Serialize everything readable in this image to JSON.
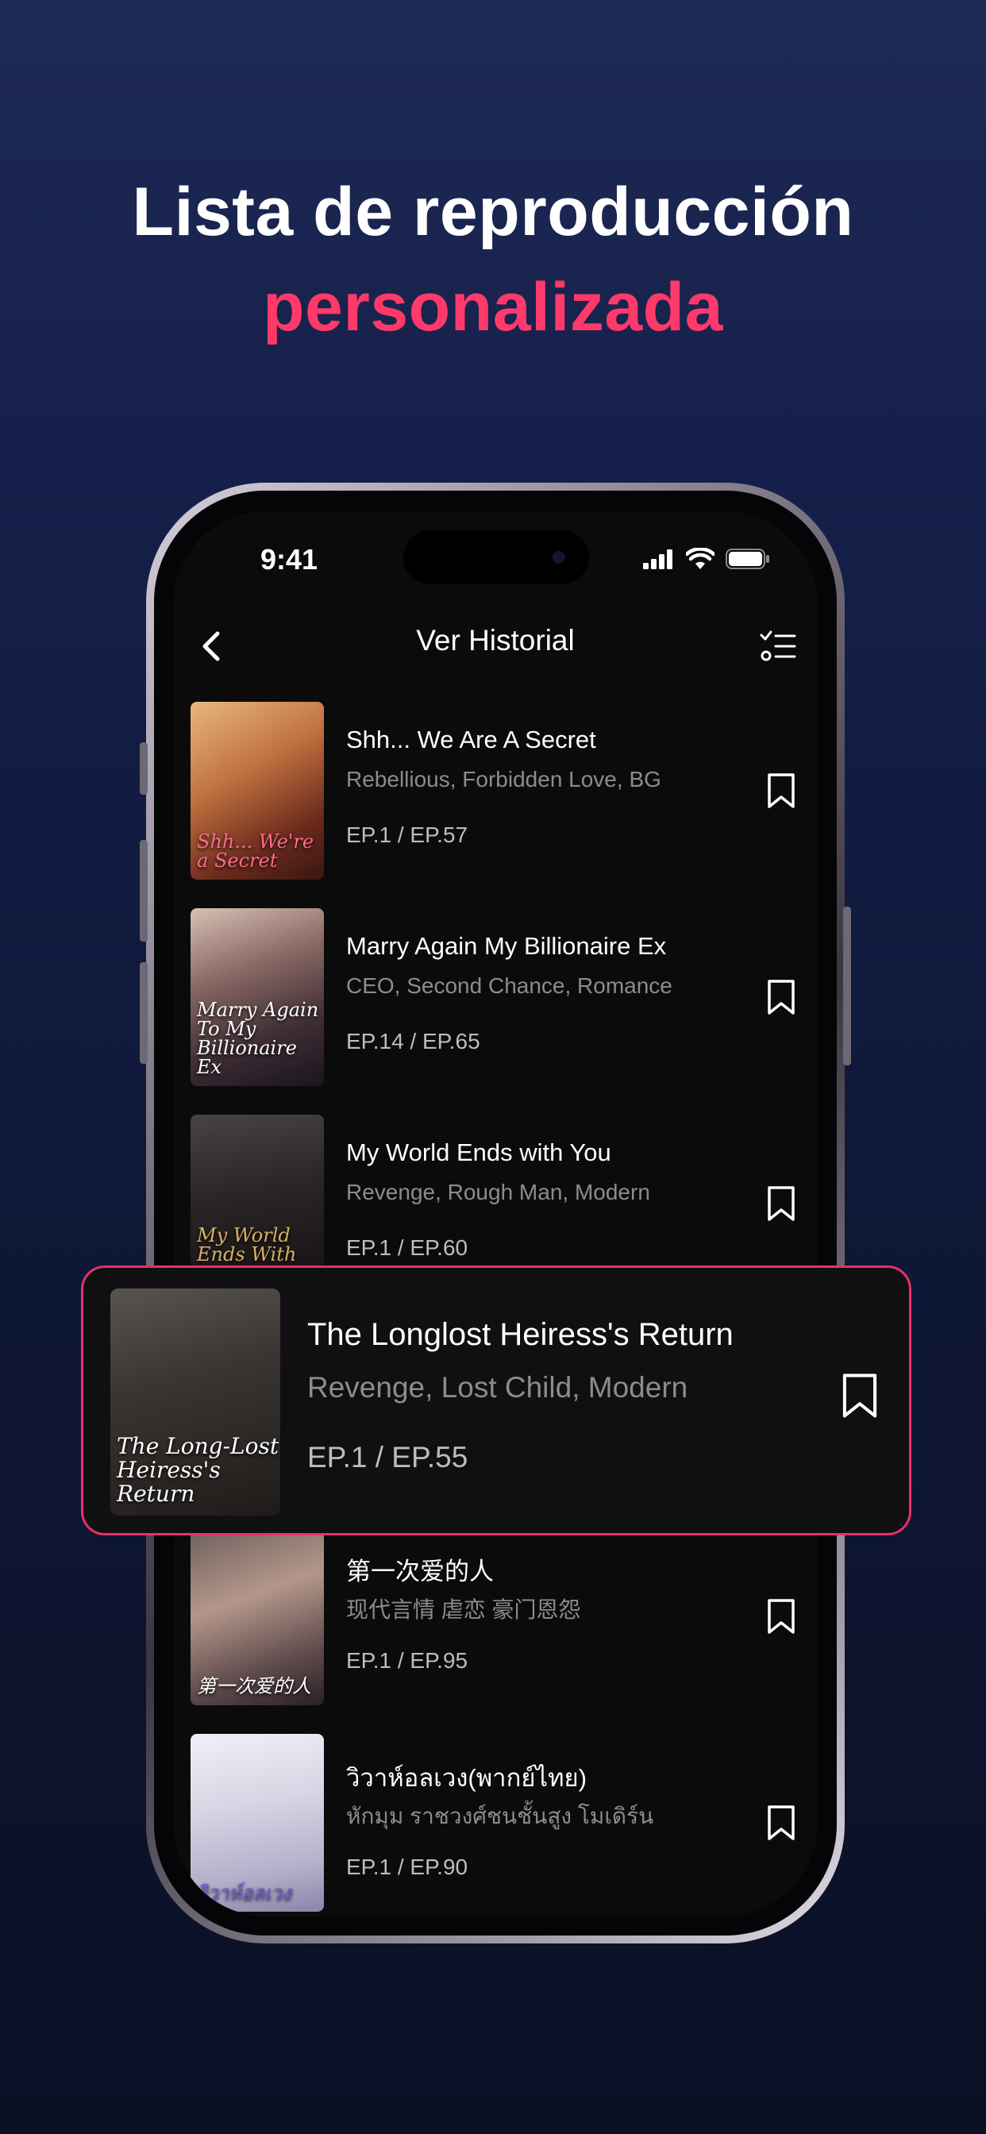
{
  "headline": {
    "line1": "Lista de reproducción",
    "line2": "personalizada"
  },
  "status_bar": {
    "time": "9:41"
  },
  "nav": {
    "title": "Ver Historial",
    "back_icon": "chevron-left-icon",
    "edit_icon": "checklist-icon"
  },
  "items": [
    {
      "title": "Shh... We Are A Secret",
      "tags": "Rebellious, Forbidden Love, BG",
      "episodes": "EP.1 / EP.57",
      "cover_text": "Shh... We're a Secret"
    },
    {
      "title": "Marry Again My Billionaire Ex",
      "tags": "CEO, Second Chance, Romance",
      "episodes": "EP.14 / EP.65",
      "cover_text": "Marry Again To My Billionaire Ex"
    },
    {
      "title": "My World Ends with You",
      "tags": "Revenge, Rough Man, Modern",
      "episodes": "EP.1 / EP.60",
      "cover_text": "My World Ends With You"
    },
    {
      "title": "第一次爱的人",
      "tags": "现代言情 虐恋 豪门恩怨",
      "episodes": "EP.1 / EP.95",
      "cover_text": "第一次爱的人"
    },
    {
      "title": "วิวาห์อลเวง(พากย์ไทย)",
      "tags": "หักมุม ราชวงศ์ชนชั้นสูง โมเดิร์น",
      "episodes": "EP.1 / EP.90",
      "cover_text": "วิวาห์อลเวง"
    }
  ],
  "featured": {
    "title": "The Longlost Heiress's Return",
    "tags": "Revenge, Lost Child, Modern",
    "episodes": "EP.1 / EP.55",
    "cover_text": "The Long-Lost Heiress's Return"
  },
  "colors": {
    "accent": "#ff3a6a",
    "card_border": "#e8306a",
    "background": "#0f1838",
    "screen": "#0b0b0c"
  }
}
